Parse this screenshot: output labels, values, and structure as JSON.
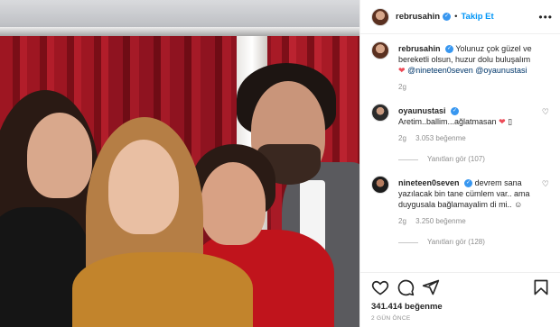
{
  "post": {
    "username": "rebrusahin",
    "follow_label": "Takip Et",
    "more_label": "•••",
    "caption": {
      "username": "rebrusahin",
      "text": "Yolunuz çok güzel ve bereketli olsun, huzur dolu buluşalım",
      "mention1": "@nineteen0seven",
      "mention2": "@oyaunustasi",
      "time": "2g"
    }
  },
  "comments": [
    {
      "username": "oyaunustasi",
      "text": "Aretim..ballim...ağlatmasan",
      "time": "2g",
      "likes": "3.053 beğenme",
      "reply_label": "Yanıtları gör (107)"
    },
    {
      "username": "nineteen0seven",
      "text": "devrem sana yazılacak bin tane cümlem var.. ama duygusala bağlamayalim di mi..",
      "time": "2g",
      "likes": "3.250 beğenme",
      "reply_label": "Yanıtları gör (128)"
    }
  ],
  "footer": {
    "likes": "341.414 beğenme",
    "date": "2 GÜN ÖNCE"
  },
  "icons": {
    "like": "heart-icon",
    "comment": "comment-icon",
    "share": "share-icon",
    "save": "bookmark-icon"
  },
  "colors": {
    "link": "#0095f6",
    "verified": "#3897f0",
    "heart": "#ed4956",
    "mention": "#00376b",
    "muted": "#8e8e8e"
  }
}
